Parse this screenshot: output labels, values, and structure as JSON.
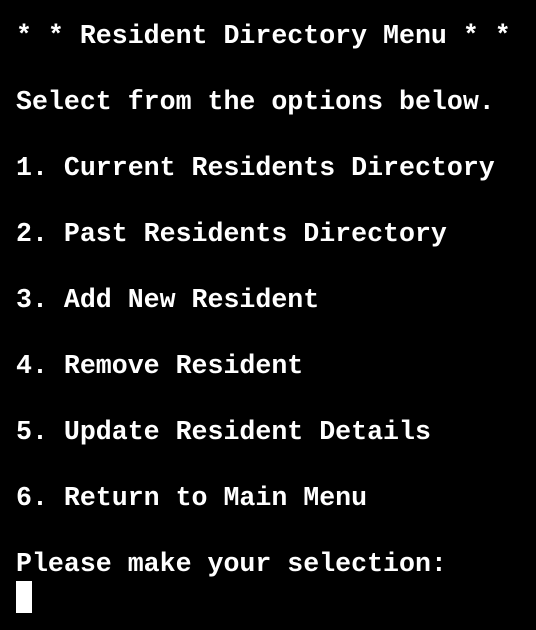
{
  "terminal": {
    "title": "* * Resident Directory Menu * *",
    "instruction": "Select from the options below.",
    "options": [
      {
        "label": "1. Current Residents Directory"
      },
      {
        "label": "2. Past Residents Directory"
      },
      {
        "label": "3. Add New Resident"
      },
      {
        "label": "4. Remove Resident"
      },
      {
        "label": "5. Update Resident Details"
      },
      {
        "label": "6. Return to Main Menu"
      }
    ],
    "prompt": "Please make your selection:",
    "input_value": ""
  },
  "colors": {
    "background": "#000000",
    "text": "#ffffff",
    "cursor": "#ffffff"
  }
}
